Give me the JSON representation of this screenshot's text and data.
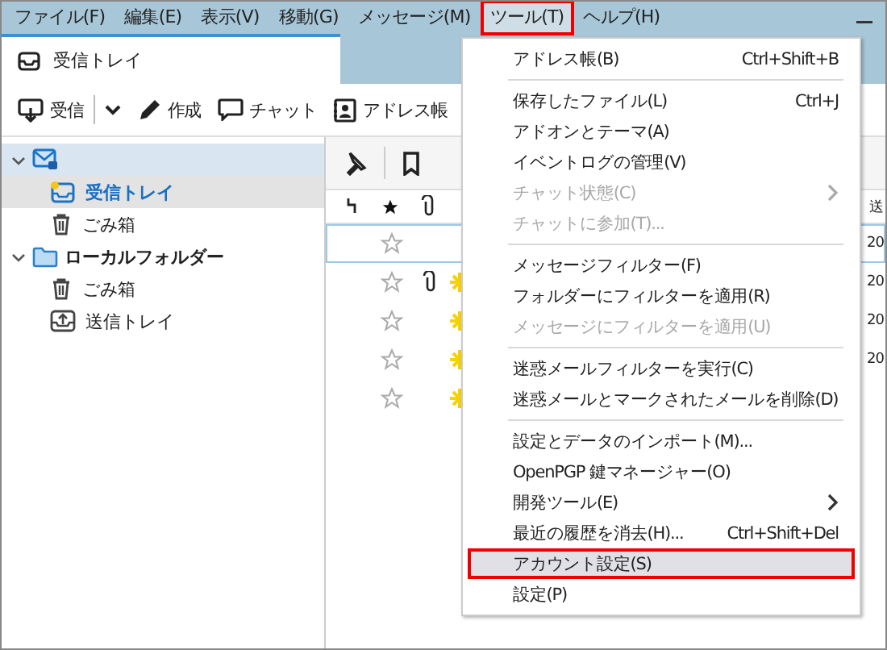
{
  "menu_bar": [
    {
      "label": "ファイル(F)",
      "selected": false
    },
    {
      "label": "編集(E)",
      "selected": false
    },
    {
      "label": "表示(V)",
      "selected": false
    },
    {
      "label": "移動(G)",
      "selected": false
    },
    {
      "label": "メッセージ(M)",
      "selected": false
    },
    {
      "label": "ツール(T)",
      "selected": true
    },
    {
      "label": "ヘルプ(H)",
      "selected": false
    }
  ],
  "tab": {
    "label": "受信トレイ"
  },
  "toolbar": [
    {
      "kind": "get",
      "label": "受信"
    },
    {
      "kind": "dropdown"
    },
    {
      "kind": "write",
      "label": "作成"
    },
    {
      "kind": "chat",
      "label": "チャット"
    },
    {
      "kind": "address",
      "label": "アドレス帳"
    }
  ],
  "folders": [
    {
      "kind": "account",
      "expanded": true,
      "children": [
        {
          "kind": "inbox",
          "label": "受信トレイ",
          "selected": true
        },
        {
          "kind": "trash",
          "label": "ごみ箱",
          "selected": false
        }
      ]
    },
    {
      "kind": "local",
      "label": "ローカルフォルダー",
      "expanded": true,
      "children": [
        {
          "kind": "trash",
          "label": "ごみ箱",
          "selected": false
        },
        {
          "kind": "outbox",
          "label": "送信トレイ",
          "selected": false
        }
      ]
    }
  ],
  "message_list": {
    "column_peek": "送",
    "rows": [
      {
        "starred": false,
        "attachment": false,
        "unread": false,
        "focused": true,
        "date_peek": "20"
      },
      {
        "starred": false,
        "attachment": true,
        "unread": true,
        "focused": false,
        "date_peek": "20"
      },
      {
        "starred": false,
        "attachment": false,
        "unread": true,
        "focused": false,
        "date_peek": "20"
      },
      {
        "starred": false,
        "attachment": false,
        "unread": true,
        "focused": false,
        "date_peek": "20"
      },
      {
        "starred": false,
        "attachment": false,
        "unread": true,
        "focused": false
      }
    ]
  },
  "tools_menu": [
    {
      "kind": "item",
      "label": "アドレス帳(B)",
      "shortcut": "Ctrl+Shift+B",
      "disabled": false,
      "submenu": false,
      "highlighted": false
    },
    {
      "kind": "separator"
    },
    {
      "kind": "item",
      "label": "保存したファイル(L)",
      "shortcut": "Ctrl+J",
      "disabled": false,
      "submenu": false,
      "highlighted": false
    },
    {
      "kind": "item",
      "label": "アドオンとテーマ(A)",
      "disabled": false,
      "submenu": false,
      "highlighted": false
    },
    {
      "kind": "item",
      "label": "イベントログの管理(V)",
      "disabled": false,
      "submenu": false,
      "highlighted": false
    },
    {
      "kind": "item",
      "label": "チャット状態(C)",
      "disabled": true,
      "submenu": true,
      "highlighted": false
    },
    {
      "kind": "item",
      "label": "チャットに参加(T)...",
      "disabled": true,
      "submenu": false,
      "highlighted": false
    },
    {
      "kind": "separator"
    },
    {
      "kind": "item",
      "label": "メッセージフィルター(F)",
      "disabled": false,
      "submenu": false,
      "highlighted": false
    },
    {
      "kind": "item",
      "label": "フォルダーにフィルターを適用(R)",
      "disabled": false,
      "submenu": false,
      "highlighted": false
    },
    {
      "kind": "item",
      "label": "メッセージにフィルターを適用(U)",
      "disabled": true,
      "submenu": false,
      "highlighted": false
    },
    {
      "kind": "separator"
    },
    {
      "kind": "item",
      "label": "迷惑メールフィルターを実行(C)",
      "disabled": false,
      "submenu": false,
      "highlighted": false
    },
    {
      "kind": "item",
      "label": "迷惑メールとマークされたメールを削除(D)",
      "disabled": false,
      "submenu": false,
      "highlighted": false
    },
    {
      "kind": "separator"
    },
    {
      "kind": "item",
      "label": "設定とデータのインポート(M)...",
      "disabled": false,
      "submenu": false,
      "highlighted": false
    },
    {
      "kind": "item",
      "label": "OpenPGP 鍵マネージャー(O)",
      "disabled": false,
      "submenu": false,
      "highlighted": false
    },
    {
      "kind": "item",
      "label": "開発ツール(E)",
      "disabled": false,
      "submenu": true,
      "highlighted": false
    },
    {
      "kind": "item",
      "label": "最近の履歴を消去(H)...",
      "shortcut": "Ctrl+Shift+Del",
      "disabled": false,
      "submenu": false,
      "highlighted": false
    },
    {
      "kind": "item",
      "label": "アカウント設定(S)",
      "disabled": false,
      "submenu": false,
      "highlighted": true
    },
    {
      "kind": "item",
      "label": "設定(P)",
      "disabled": false,
      "submenu": false,
      "highlighted": false
    }
  ]
}
